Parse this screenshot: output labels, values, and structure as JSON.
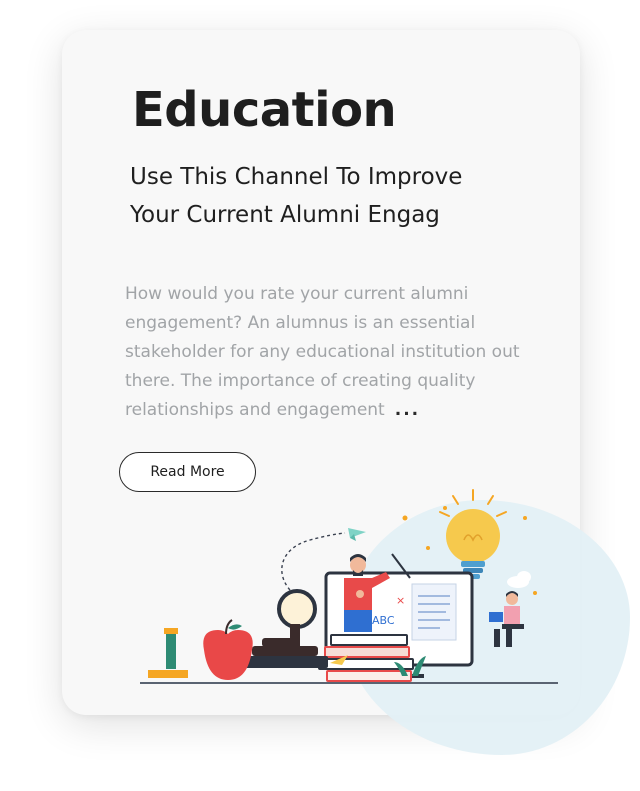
{
  "card": {
    "title": "Education",
    "subtitle_line1": "Use This Channel To Improve",
    "subtitle_line2": "Your Current Alumni Engag",
    "body": "How would you rate your current alumni engagement? An alumnus is an essential stakeholder for any educational institution out there. The importance of creating quality relationships and engagement",
    "ellipsis": "...",
    "button_label": "Read More"
  },
  "illustration": {
    "board_letters": "ABC",
    "icons": [
      "apple-icon",
      "lightbulb-icon",
      "magnifier-icon",
      "books-icon",
      "monitor-icon",
      "teacher-figure",
      "student-figure",
      "paper-plane-icon",
      "cloud-icon"
    ]
  },
  "colors": {
    "accent_red": "#e94848",
    "accent_yellow": "#f5c542",
    "accent_blue": "#3d7bd9",
    "blob": "#e3f0f5"
  }
}
